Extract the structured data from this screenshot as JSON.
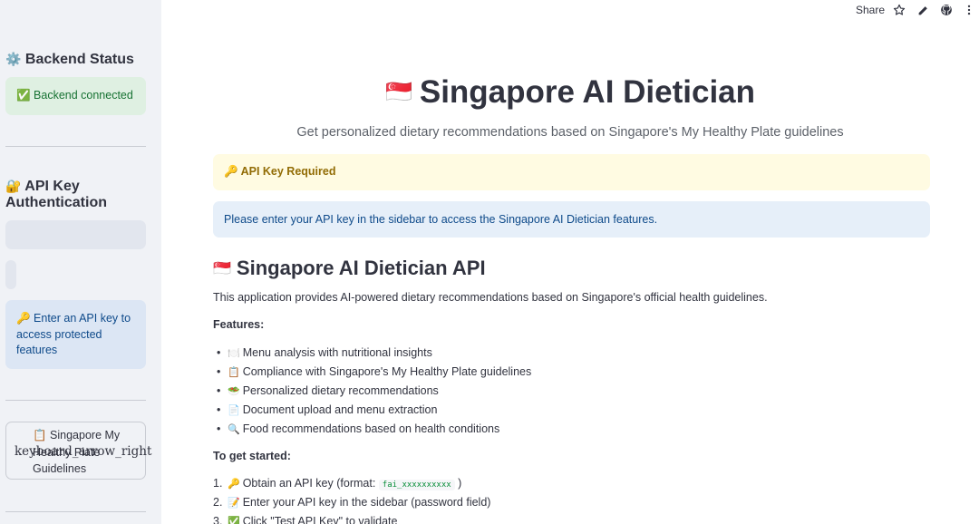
{
  "toolbar": {
    "share_label": "Share",
    "icons": [
      "star-icon",
      "edit-icon",
      "github-icon",
      "more-icon"
    ]
  },
  "sidebar": {
    "backend_heading_icon": "⚙️",
    "backend_heading": "Backend Status",
    "backend_status": "✅ Backend connected",
    "auth_heading_icon": "🔐",
    "auth_heading": "API Key Authentication",
    "auth_info": "🔑 Enter an API key to access protected features",
    "expander_label": "📋 Singapore My Healthy Plate Guidelines",
    "expander_icon_text": "keyboard_arrow_right"
  },
  "main": {
    "title_flag": "🇸🇬",
    "title": "Singapore AI Dietician",
    "subtitle": "Get personalized dietary recommendations based on Singapore's My Healthy Plate guidelines",
    "warning": "🔑 API Key Required",
    "info": "Please enter your API key in the sidebar to access the Singapore AI Dietician features.",
    "section_flag": "🇸🇬",
    "section_title": "Singapore AI Dietician API",
    "intro": "This application provides AI-powered dietary recommendations based on Singapore's official health guidelines.",
    "features_heading": "Features:",
    "features": [
      {
        "icon": "🍽️",
        "text": "Menu analysis with nutritional insights"
      },
      {
        "icon": "📋",
        "text": "Compliance with Singapore's My Healthy Plate guidelines"
      },
      {
        "icon": "🥗",
        "text": "Personalized dietary recommendations"
      },
      {
        "icon": "📄",
        "text": "Document upload and menu extraction"
      },
      {
        "icon": "🔍",
        "text": "Food recommendations based on health conditions"
      }
    ],
    "getting_started_heading": "To get started:",
    "steps": [
      {
        "num": "1.",
        "icon": "🔑",
        "text": "Obtain an API key (format:",
        "code": "fai_xxxxxxxxxx",
        "suffix": ")"
      },
      {
        "num": "2.",
        "icon": "📝",
        "text": "Enter your API key in the sidebar (password field)"
      },
      {
        "num": "3.",
        "icon": "✅",
        "text": "Click \"Test API Key\" to validate"
      }
    ]
  }
}
